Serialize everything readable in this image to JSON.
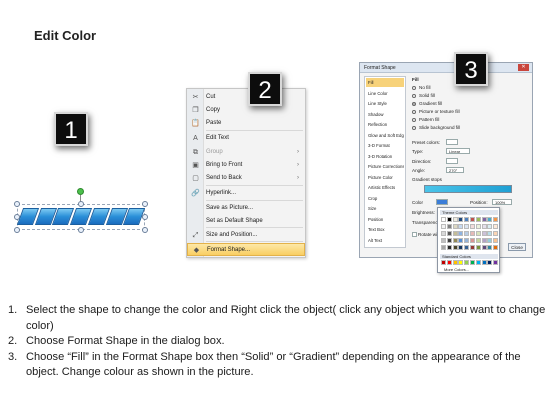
{
  "title": "Edit Color",
  "badges": [
    "1",
    "2",
    "3"
  ],
  "context_menu": {
    "items": [
      {
        "icon": "scissors-icon",
        "glyph": "✂",
        "label": "Cut",
        "disabled": false
      },
      {
        "icon": "copy-icon",
        "glyph": "❐",
        "label": "Copy",
        "disabled": false
      },
      {
        "icon": "paste-icon",
        "glyph": "📋",
        "label": "Paste",
        "disabled": false
      },
      {
        "icon": "edit-text-icon",
        "glyph": "A",
        "label": "Edit Text",
        "disabled": false
      },
      {
        "icon": "group-icon",
        "glyph": "⧉",
        "label": "Group",
        "disabled": true,
        "submenu": true
      },
      {
        "icon": "bring-to-front-icon",
        "glyph": "▣",
        "label": "Bring to Front",
        "disabled": false,
        "submenu": true
      },
      {
        "icon": "send-to-back-icon",
        "glyph": "▢",
        "label": "Send to Back",
        "disabled": false,
        "submenu": true
      },
      {
        "icon": "hyperlink-icon",
        "glyph": "🔗",
        "label": "Hyperlink...",
        "disabled": false
      },
      {
        "icon": "",
        "glyph": "",
        "label": "Save as Picture...",
        "disabled": false
      },
      {
        "icon": "",
        "glyph": "",
        "label": "Set as Default Shape",
        "disabled": false
      },
      {
        "icon": "size-position-icon",
        "glyph": "⤢",
        "label": "Size and Position...",
        "disabled": false
      },
      {
        "icon": "format-shape-icon",
        "glyph": "◆",
        "label": "Format Shape...",
        "disabled": false,
        "highlighted": true
      }
    ]
  },
  "dialog": {
    "title": "Format Shape",
    "nav": [
      "Fill",
      "Line Color",
      "Line Style",
      "Shadow",
      "Reflection",
      "Glow and Soft Edges",
      "3-D Format",
      "3-D Rotation",
      "Picture Corrections",
      "Picture Color",
      "Artistic Effects",
      "Crop",
      "Size",
      "Position",
      "Text Box",
      "Alt Text"
    ],
    "fill_heading": "Fill",
    "fill_options": [
      "No fill",
      "Solid fill",
      "Gradient fill",
      "Picture or texture fill",
      "Pattern fill",
      "Slide background fill"
    ],
    "selected_fill": "Gradient fill",
    "labels": {
      "preset": "Preset colors:",
      "type": "Type:",
      "type_value": "Linear",
      "direction": "Direction:",
      "angle": "Angle:",
      "angle_value": "270°",
      "stops": "Gradient stops",
      "color": "Color",
      "position": "Position:",
      "position_value": "100%",
      "brightness": "Brightness:",
      "transparency": "Transparency:",
      "rotate": "Rotate with shape",
      "close": "Close"
    },
    "palette": {
      "theme_header": "Theme Colors",
      "standard_header": "Standard Colors",
      "more": "More Colors...",
      "theme_rows": [
        [
          "#ffffff",
          "#000000",
          "#eeece1",
          "#1f497d",
          "#4f81bd",
          "#c0504d",
          "#9bbb59",
          "#8064a2",
          "#4bacc6",
          "#f79646"
        ],
        [
          "#f2f2f2",
          "#7f7f7f",
          "#ddd9c3",
          "#c6d9f0",
          "#dbe5f1",
          "#f2dcdb",
          "#ebf1dd",
          "#e5e0ec",
          "#dbeef3",
          "#fdeada"
        ],
        [
          "#d8d8d8",
          "#595959",
          "#c4bd97",
          "#8db3e2",
          "#b8cce4",
          "#e5b9b7",
          "#d7e3bc",
          "#ccc1d9",
          "#b7dde8",
          "#fbd5b5"
        ],
        [
          "#bfbfbf",
          "#3f3f3f",
          "#938953",
          "#548dd4",
          "#95b3d7",
          "#d99694",
          "#c3d69b",
          "#b2a2c7",
          "#92cddc",
          "#fac08f"
        ],
        [
          "#a5a5a5",
          "#262626",
          "#494429",
          "#17365d",
          "#366092",
          "#953734",
          "#76923c",
          "#5f497a",
          "#31859b",
          "#e36c09"
        ]
      ],
      "standard": [
        "#c00000",
        "#ff0000",
        "#ffc000",
        "#ffff00",
        "#92d050",
        "#00b050",
        "#00b0f0",
        "#0070c0",
        "#002060",
        "#7030a0"
      ]
    }
  },
  "instructions": [
    {
      "num": "1.",
      "text": "Select the shape to change the color and Right click the object( click any object which you want to change color)"
    },
    {
      "num": "2.",
      "text": "Choose Format Shape in the dialog box."
    },
    {
      "num": "3.",
      "text": "Choose “Fill” in the Format Shape box then “Solid” or “Gradient” depending on the appearance of the object. Change colour as shown in the picture."
    }
  ]
}
